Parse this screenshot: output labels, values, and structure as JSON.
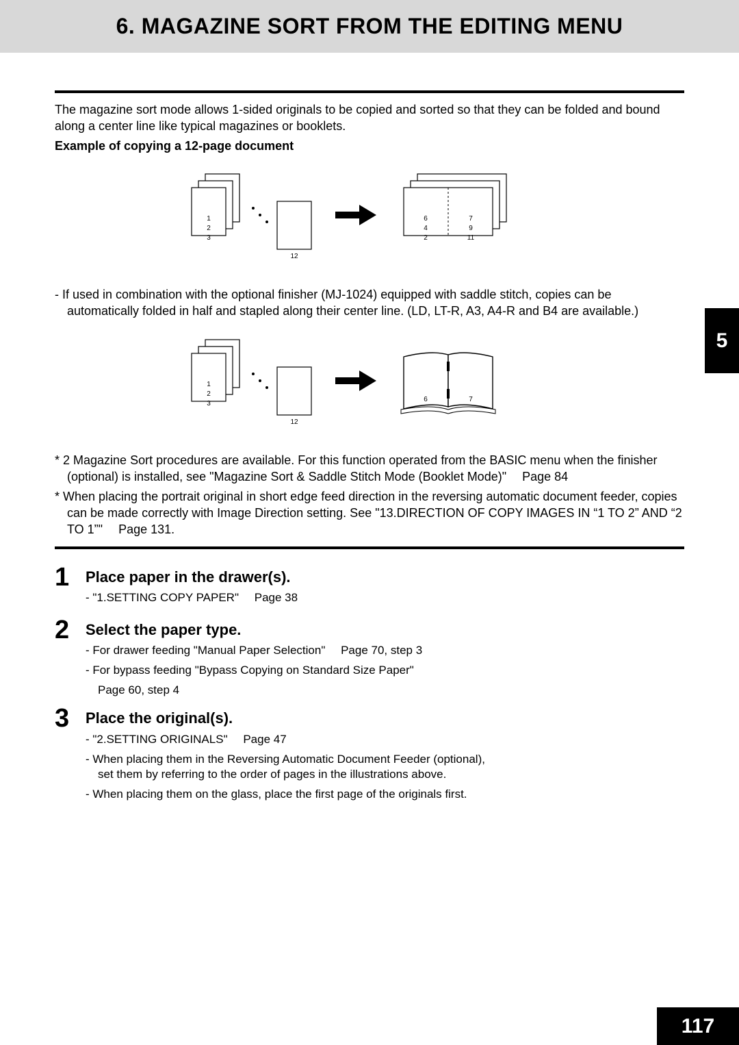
{
  "header": {
    "title": "6. MAGAZINE SORT FROM THE EDITING MENU"
  },
  "intro": "The magazine sort mode allows 1-sided originals to be copied and sorted so that they can be folded and bound along a center line like typical magazines or booklets.",
  "example_label": "Example of copying a 12-page document",
  "figure1": {
    "src_labels": [
      "1",
      "2",
      "3",
      "12"
    ],
    "out_labels": [
      "6",
      "7",
      "4",
      "9",
      "2",
      "11"
    ]
  },
  "finisher_note": "-  If used in combination with the optional finisher (MJ-1024) equipped with saddle stitch, copies can be automatically folded in half and stapled along their center line. (LD, LT-R, A3, A4-R and B4 are available.)",
  "figure2": {
    "src_labels": [
      "1",
      "2",
      "3",
      "12"
    ],
    "out_labels": [
      "6",
      "7"
    ]
  },
  "notes": [
    {
      "text": "*  2 Magazine Sort procedures are available. For this function operated from the BASIC menu when the finisher (optional) is installed, see \"Magazine Sort & Saddle Stitch Mode (Booklet Mode)\"",
      "pref": "Page 84"
    },
    {
      "text": "*  When placing the portrait original in short edge feed direction in the reversing automatic document feeder, copies can be made correctly with Image Direction setting. See \"13.DIRECTION OF COPY IMAGES IN “1 TO 2” AND “2 TO 1”\"",
      "pref": "Page 131."
    }
  ],
  "steps": [
    {
      "num": "1",
      "title": "Place paper in the drawer(s).",
      "subs": [
        {
          "text": "-  \"1.SETTING COPY PAPER\"",
          "pref": "Page 38"
        }
      ]
    },
    {
      "num": "2",
      "title": "Select the paper type.",
      "subs": [
        {
          "text": "-  For drawer feeding \"Manual Paper Selection\"",
          "pref": "Page 70, step 3"
        },
        {
          "text": "-  For bypass feeding \"Bypass Copying on Standard Size Paper\"",
          "cont": "Page 60, step 4"
        }
      ]
    },
    {
      "num": "3",
      "title": "Place the original(s).",
      "subs": [
        {
          "text": "-  \"2.SETTING ORIGINALS\"",
          "pref": "Page 47"
        },
        {
          "text": "-  When placing them in the Reversing Automatic Document Feeder (optional), set them by referring to the order of pages in the illustrations above."
        },
        {
          "text": "-  When placing them on the glass, place the first page of the originals first."
        }
      ]
    }
  ],
  "chapter_tab": "5",
  "page_number": "117"
}
